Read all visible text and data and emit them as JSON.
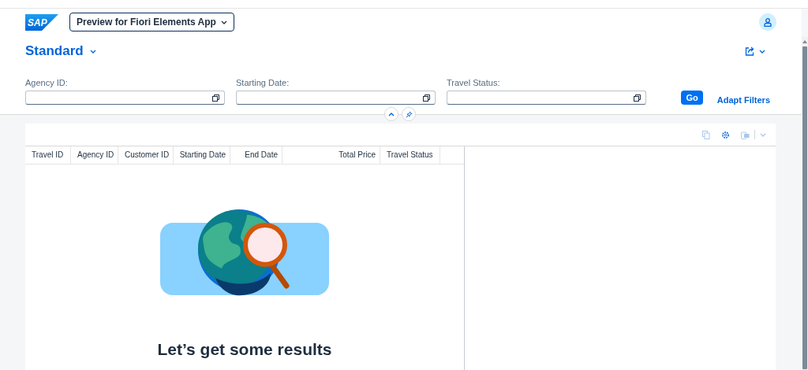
{
  "shell": {
    "logo": "SAP",
    "app_title": "Preview for Fiori Elements App"
  },
  "header": {
    "variant": "Standard"
  },
  "filter_bar": {
    "filters": [
      {
        "label": "Agency ID:"
      },
      {
        "label": "Starting Date:"
      },
      {
        "label": "Travel Status:"
      }
    ],
    "go": "Go",
    "adapt_filters": "Adapt Filters"
  },
  "table": {
    "columns": [
      {
        "label": "Travel ID"
      },
      {
        "label": "Agency ID"
      },
      {
        "label": "Customer ID"
      },
      {
        "label": "Starting Date"
      },
      {
        "label": "End Date"
      },
      {
        "label": "Total Price"
      },
      {
        "label": "Travel Status"
      }
    ]
  },
  "empty_state": {
    "title": "Let’s get some results"
  }
}
